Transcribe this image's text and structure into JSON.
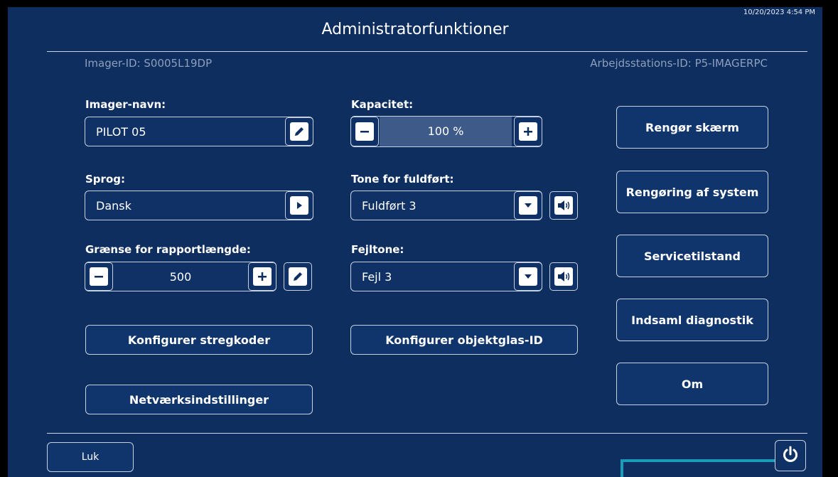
{
  "header": {
    "timestamp": "10/20/2023 4:54 PM",
    "title": "Administratorfunktioner",
    "imager_id": "Imager-ID: S0005L19DP",
    "workstation_id": "Arbejdsstations-ID: P5-IMAGERPC"
  },
  "left": {
    "imager_name_label": "Imager-navn:",
    "imager_name_value": "PILOT 05",
    "language_label": "Sprog:",
    "language_value": "Dansk",
    "report_limit_label": "Grænse for rapportlængde:",
    "report_limit_value": "500",
    "configure_barcodes": "Konfigurer stregkoder",
    "network_settings": "Netværksindstillinger"
  },
  "middle": {
    "capacity_label": "Kapacitet:",
    "capacity_value": "100 %",
    "done_tone_label": "Tone for fuldført:",
    "done_tone_value": "Fuldført 3",
    "error_tone_label": "Fejltone:",
    "error_tone_value": "Fejl 3",
    "configure_slide_id": "Konfigurer objektglas-ID"
  },
  "right": {
    "clean_screen": "Rengør skærm",
    "system_cleaning": "Rengøring af system",
    "service_mode": "Servicetilstand",
    "collect_diagnostics": "Indsaml diagnostik",
    "about": "Om"
  },
  "footer": {
    "close": "Luk"
  },
  "colors": {
    "background": "#0d2e5e",
    "accent_line": "#1a9bb8"
  }
}
